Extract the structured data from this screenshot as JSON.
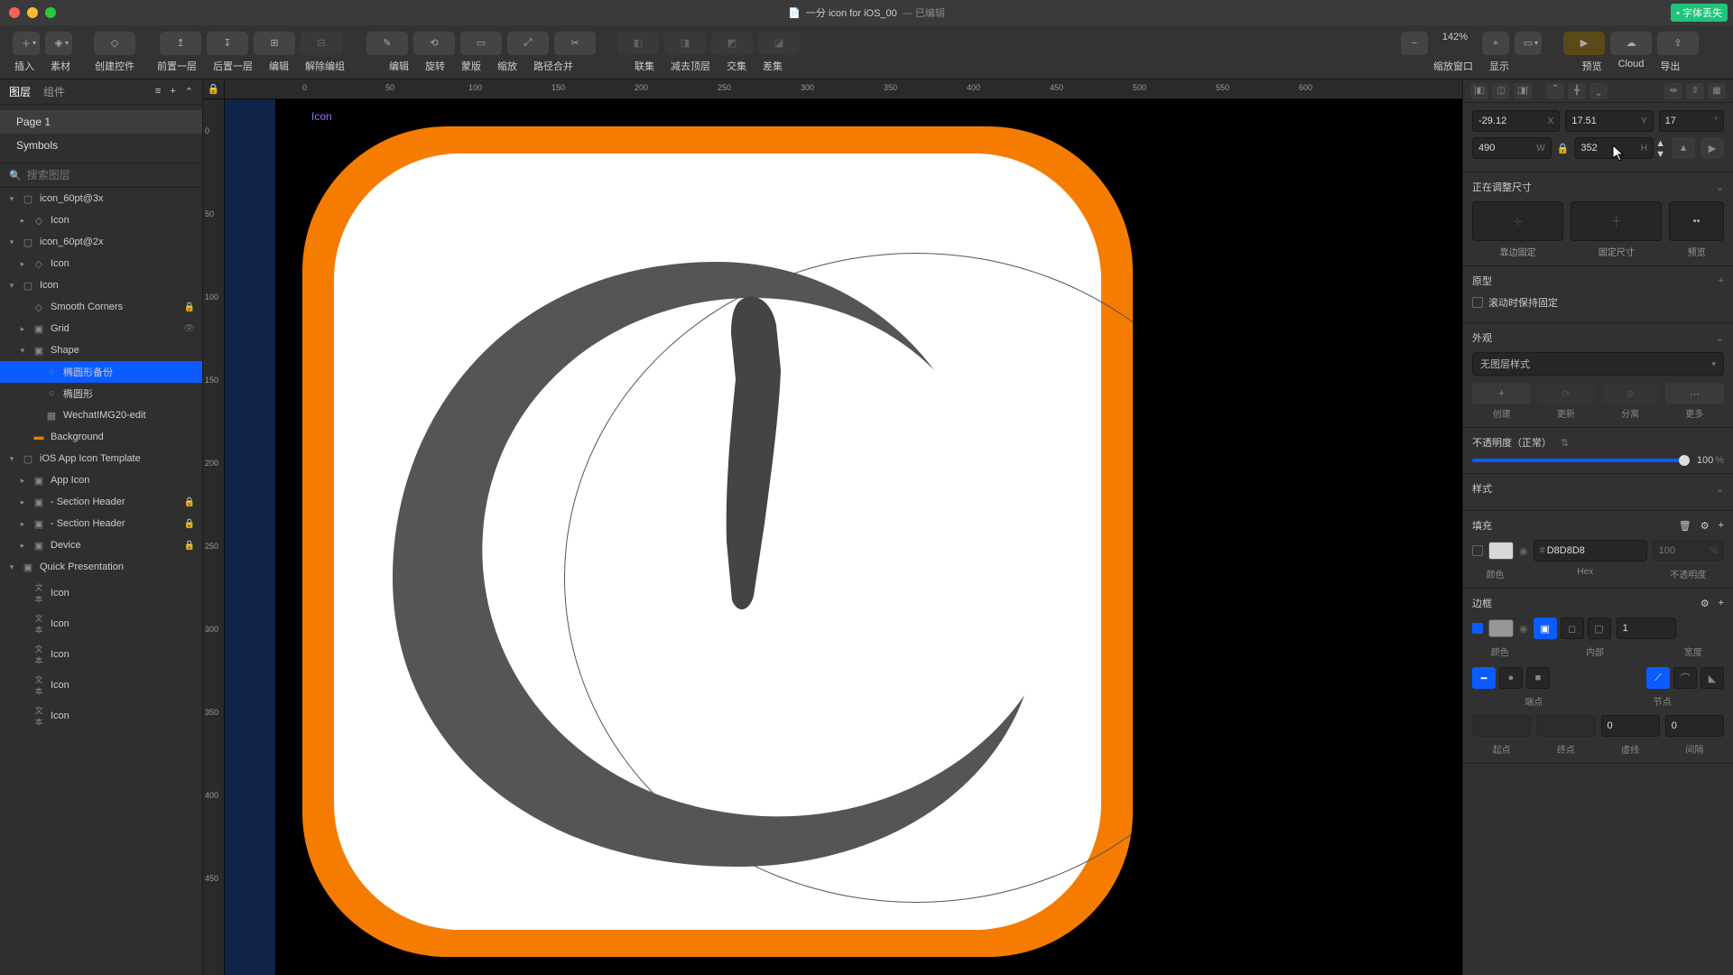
{
  "window": {
    "title": "一分 icon for iOS_00",
    "status": "— 已编辑",
    "font_missing": "• 字体丢失"
  },
  "toolbar": {
    "insert": "插入",
    "assets": "素材",
    "create_ctrl": "创建控件",
    "forward": "前置一层",
    "backward": "后置一层",
    "edit": "编辑",
    "ungroup": "解除编组",
    "edit2": "编辑",
    "rotate": "旋转",
    "mask": "蒙版",
    "scale": "缩放",
    "path_merge": "路径合并",
    "union": "联集",
    "subtract": "减去顶层",
    "intersect": "交集",
    "difference": "差集",
    "zoom_lbl": "缩放窗口",
    "zoom_val": "142%",
    "view": "显示",
    "preview": "预览",
    "cloud": "Cloud",
    "export": "导出"
  },
  "left": {
    "tab_layers": "图层",
    "tab_components": "组件",
    "page1": "Page 1",
    "symbols": "Symbols",
    "search_ph": "搜索图层",
    "artboards": {
      "ab1": "icon_60pt@3x",
      "ab1_child": "Icon",
      "ab2": "icon_60pt@2x",
      "ab2_child": "Icon",
      "ab3": "Icon",
      "smooth": "Smooth Corners",
      "grid": "Grid",
      "shape": "Shape",
      "oval_copy": "椭圆形备份",
      "oval": "椭圆形",
      "img": "WechatIMG20-edit",
      "bg": "Background",
      "template": "iOS App Icon Template",
      "app_icon": "App Icon",
      "sec_h1": "- Section Header",
      "sec_h2": "- Section Header",
      "device": "Device",
      "quick": "Quick Presentation",
      "icon1": "Icon",
      "icon2": "Icon",
      "icon3": "Icon",
      "icon4": "Icon",
      "icon5": "Icon"
    }
  },
  "canvas": {
    "artboard_label": "Icon"
  },
  "inspector": {
    "x": "-29.12",
    "y": "17.51",
    "rot": "17",
    "w": "490",
    "h": "352",
    "resize_head": "正在调整尺寸",
    "pin": "靠边固定",
    "fix": "固定尺寸",
    "preview": "预览",
    "proto_head": "原型",
    "scroll_fix": "滚动时保持固定",
    "appearance_head": "外观",
    "no_style": "无图层样式",
    "create": "创建",
    "update": "更新",
    "detach": "分离",
    "more": "更多",
    "opacity_lbl": "不透明度（正常）",
    "opacity_val": "100",
    "style_head": "样式",
    "fill_head": "填充",
    "color_lbl": "颜色",
    "hex_lbl": "Hex",
    "hex_val": "D8D8D8",
    "op_lbl": "不透明度",
    "fill_op": "100",
    "border_head": "边框",
    "inside_lbl": "内部",
    "width_lbl": "宽度",
    "border_w": "1",
    "ends_lbl": "端点",
    "joins_lbl": "节点",
    "start_lbl": "起点",
    "end_lbl": "终点",
    "dash_lbl": "虚线",
    "dash_val": "0",
    "gap_lbl": "间隔",
    "gap_val": "0"
  },
  "ruler_h": [
    "0",
    "50",
    "100",
    "150",
    "200",
    "250",
    "300",
    "350",
    "400",
    "450",
    "500",
    "550",
    "600"
  ],
  "ruler_v": [
    "0",
    "50",
    "100",
    "150",
    "200",
    "250",
    "300",
    "350",
    "400",
    "450"
  ]
}
